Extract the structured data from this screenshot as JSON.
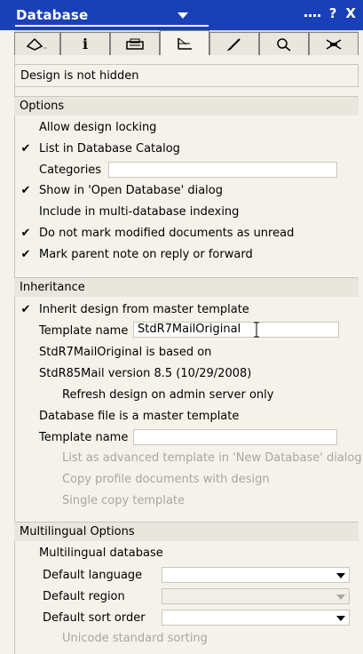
{
  "title": "Database",
  "title_icons": {
    "help": "?",
    "close": "X"
  },
  "tabs": [
    "info-icon",
    "tools-icon",
    "print-icon",
    "design-icon",
    "pen-icon",
    "search-icon",
    "network-icon"
  ],
  "status": "Design is not hidden",
  "options": {
    "header": "Options",
    "allow_design_locking": "Allow design locking",
    "list_in_catalog": "List in Database Catalog",
    "categories_label": "Categories",
    "show_open_db": "Show in 'Open Database' dialog",
    "include_multi_index": "Include in multi-database indexing",
    "do_not_mark_unread": "Do not mark modified documents as unread",
    "mark_parent_note": "Mark parent note on reply or forward"
  },
  "inheritance": {
    "header": "Inheritance",
    "inherit_design": "Inherit design from master template",
    "template_name_label": "Template name",
    "template_name_value": "StdR7MailOriginal",
    "based_on_line1": "StdR7MailOriginal is based on",
    "based_on_line2": "StdR85Mail version 8.5 (10/29/2008)",
    "refresh_admin": "Refresh design on admin server only",
    "db_master_template": "Database file is a master template",
    "template_name_label2": "Template name",
    "list_advanced": "List as advanced template in 'New Database' dialog",
    "copy_profile_docs": "Copy profile documents with design",
    "single_copy": "Single copy template"
  },
  "multilingual": {
    "header": "Multilingual Options",
    "multilingual_db": "Multilingual database",
    "default_language": "Default language",
    "default_region": "Default region",
    "default_sort_order": "Default sort order",
    "unicode_sorting": "Unicode standard sorting"
  },
  "checks": {
    "list_in_catalog": "✔",
    "show_open_db": "✔",
    "do_not_mark_unread": "✔",
    "mark_parent_note": "✔",
    "inherit_design": "✔"
  },
  "colors": {
    "titlebar": "#1a40b8",
    "panel": "#f4f2ea",
    "section": "#e9e6dd"
  }
}
